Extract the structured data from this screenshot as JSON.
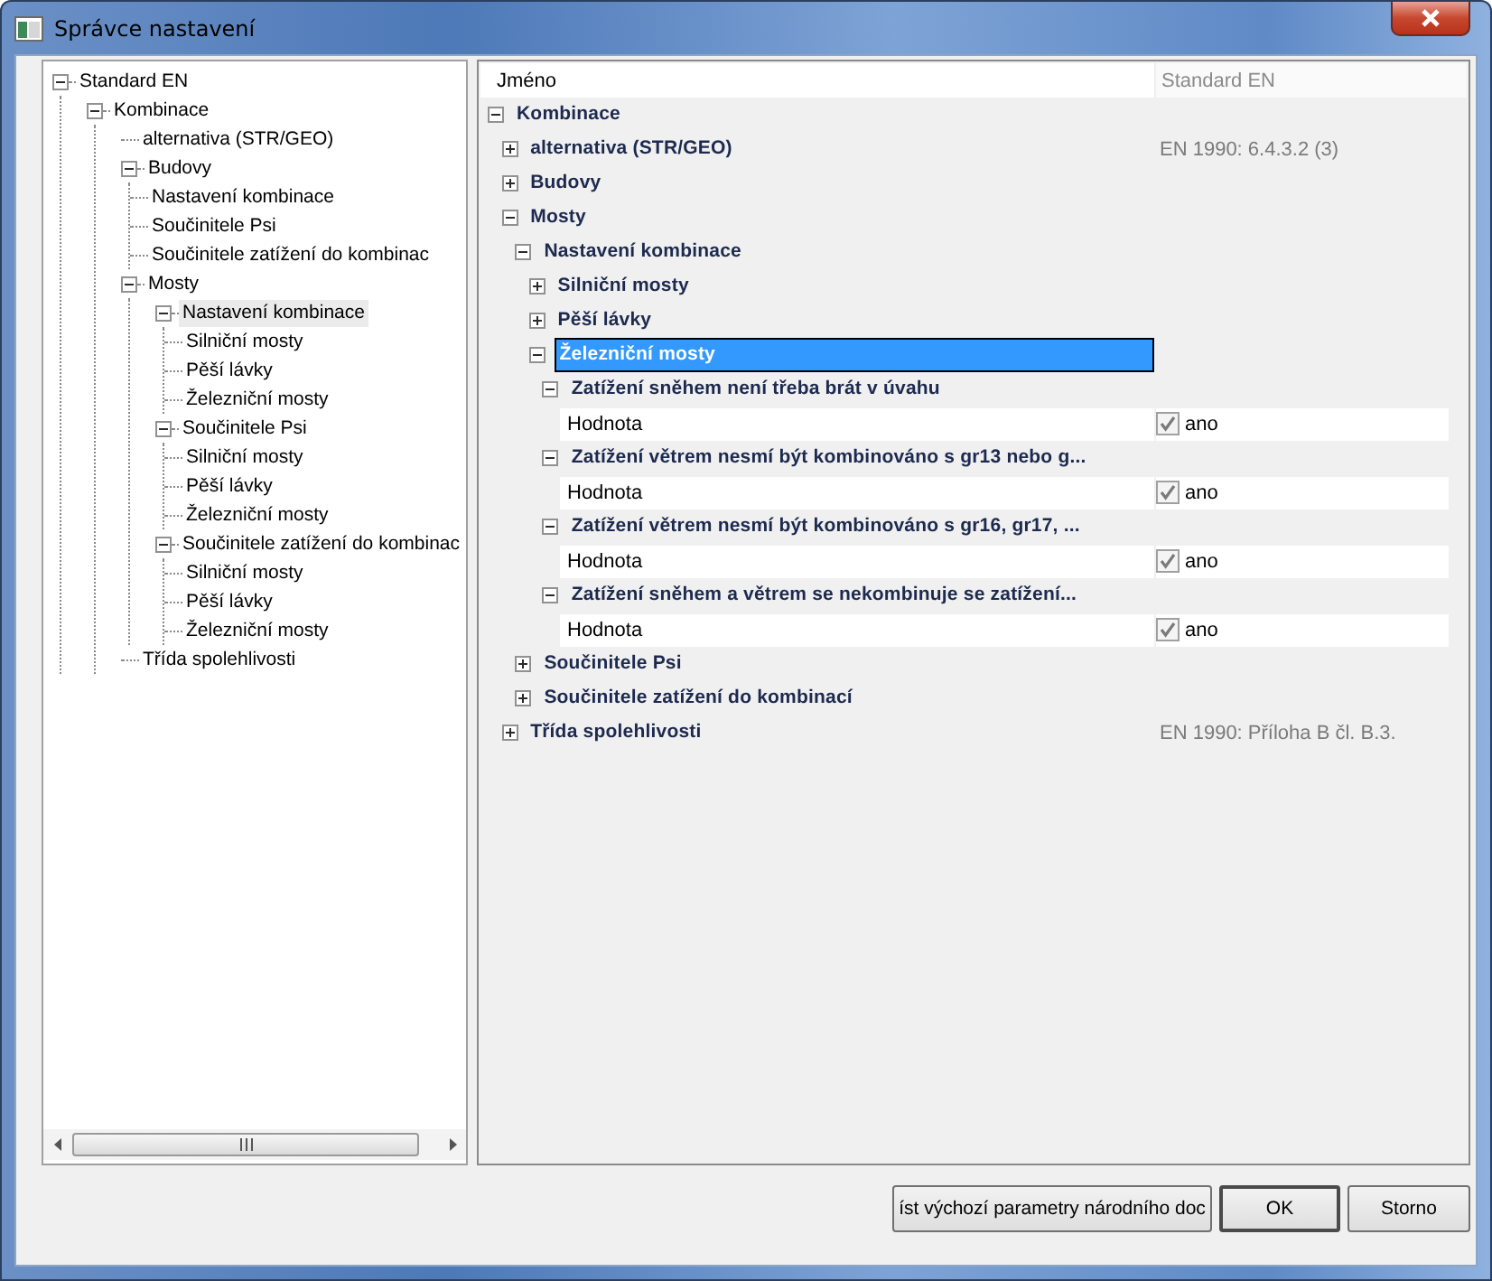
{
  "window": {
    "title": "Správce nastavení"
  },
  "tree": [
    {
      "label": "Standard EN",
      "expanded": true,
      "selected": false,
      "children": [
        {
          "label": "Kombinace",
          "expanded": true,
          "selected": false,
          "children": [
            {
              "label": "alternativa (STR/GEO)",
              "selected": false
            },
            {
              "label": "Budovy",
              "expanded": true,
              "selected": false,
              "children": [
                {
                  "label": "Nastavení kombinace",
                  "selected": false
                },
                {
                  "label": "Součinitele Psi",
                  "selected": false
                },
                {
                  "label": "Součinitele zatížení do kombinac",
                  "selected": false
                }
              ]
            },
            {
              "label": "Mosty",
              "expanded": true,
              "selected": false,
              "children": [
                {
                  "label": "Nastavení kombinace",
                  "expanded": true,
                  "selected": true,
                  "children": [
                    {
                      "label": "Silniční mosty",
                      "selected": false
                    },
                    {
                      "label": "Pěší lávky",
                      "selected": false
                    },
                    {
                      "label": "Železniční mosty",
                      "selected": false
                    }
                  ]
                },
                {
                  "label": "Součinitele Psi",
                  "expanded": true,
                  "selected": false,
                  "children": [
                    {
                      "label": "Silniční mosty",
                      "selected": false
                    },
                    {
                      "label": "Pěší lávky",
                      "selected": false
                    },
                    {
                      "label": "Železniční mosty",
                      "selected": false
                    }
                  ]
                },
                {
                  "label": "Součinitele zatížení do kombinac",
                  "expanded": true,
                  "selected": false,
                  "children": [
                    {
                      "label": "Silniční mosty",
                      "selected": false
                    },
                    {
                      "label": "Pěší lávky",
                      "selected": false
                    },
                    {
                      "label": "Železniční mosty",
                      "selected": false
                    }
                  ]
                }
              ]
            },
            {
              "label": "Třída spolehlivosti",
              "selected": false
            }
          ]
        }
      ]
    }
  ],
  "grid": {
    "columns": [
      "Jméno",
      "Standard EN"
    ],
    "rows": [
      {
        "kind": "category",
        "label": "Kombinace",
        "expanded": true,
        "selected": false,
        "children": [
          {
            "kind": "category",
            "label": "alternativa (STR/GEO)",
            "value": "EN 1990: 6.4.3.2 (3)",
            "expanded": false,
            "selected": false
          },
          {
            "kind": "category",
            "label": "Budovy",
            "expanded": false,
            "selected": false
          },
          {
            "kind": "category",
            "label": "Mosty",
            "expanded": true,
            "selected": false,
            "children": [
              {
                "kind": "category",
                "label": "Nastavení kombinace",
                "expanded": true,
                "selected": false,
                "children": [
                  {
                    "kind": "category",
                    "label": "Silniční mosty",
                    "expanded": false,
                    "selected": false
                  },
                  {
                    "kind": "category",
                    "label": "Pěší lávky",
                    "expanded": false,
                    "selected": false
                  },
                  {
                    "kind": "category",
                    "label": "Železniční mosty",
                    "expanded": true,
                    "selected": true,
                    "children": [
                      {
                        "kind": "category",
                        "label": "Zatížení sněhem není třeba brát v úvahu",
                        "expanded": true,
                        "selected": false,
                        "children": [
                          {
                            "kind": "property",
                            "label": "Hodnota",
                            "value": "ano",
                            "checked": true
                          }
                        ]
                      },
                      {
                        "kind": "category",
                        "label": "Zatížení větrem nesmí být kombinováno s gr13 nebo g...",
                        "expanded": true,
                        "selected": false,
                        "children": [
                          {
                            "kind": "property",
                            "label": "Hodnota",
                            "value": "ano",
                            "checked": true
                          }
                        ]
                      },
                      {
                        "kind": "category",
                        "label": "Zatížení větrem nesmí být kombinováno s gr16, gr17, ...",
                        "expanded": true,
                        "selected": false,
                        "children": [
                          {
                            "kind": "property",
                            "label": "Hodnota",
                            "value": "ano",
                            "checked": true
                          }
                        ]
                      },
                      {
                        "kind": "category",
                        "label": "Zatížení sněhem a větrem se nekombinuje se zatížení...",
                        "expanded": true,
                        "selected": false,
                        "children": [
                          {
                            "kind": "property",
                            "label": "Hodnota",
                            "value": "ano",
                            "checked": true
                          }
                        ]
                      }
                    ]
                  }
                ]
              },
              {
                "kind": "category",
                "label": "Součinitele Psi",
                "expanded": false,
                "selected": false
              },
              {
                "kind": "category",
                "label": "Součinitele zatížení do kombinací",
                "expanded": false,
                "selected": false
              }
            ]
          },
          {
            "kind": "category",
            "label": "Třída spolehlivosti",
            "value": "EN 1990: Příloha B čl. B.3.",
            "expanded": false,
            "selected": false
          }
        ]
      }
    ]
  },
  "buttons": [
    "íst výchozí parametry národního doc",
    "OK",
    "Storno"
  ]
}
